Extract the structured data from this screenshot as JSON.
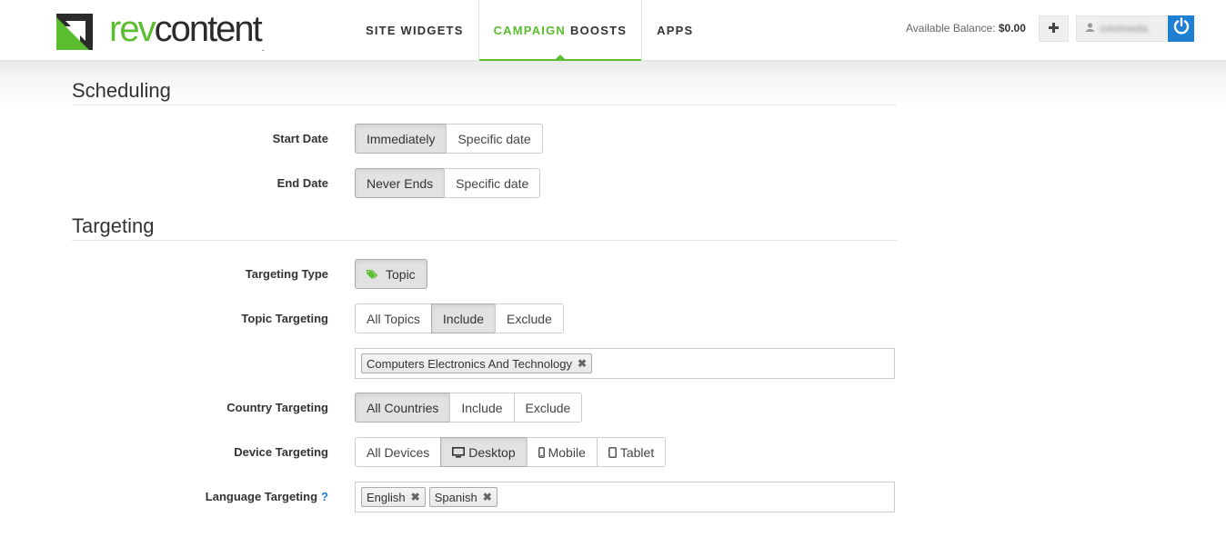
{
  "brand": {
    "name_part1": "rev",
    "name_part2": "content",
    "name_suffix": ".",
    "primary_color": "#5bbd2f",
    "accent_blue": "#1f7fd0"
  },
  "nav": {
    "items": [
      {
        "label": "SITE WIDGETS",
        "active": false
      },
      {
        "label_green": "CAMPAIGN",
        "label": "BOOSTS",
        "active": true
      },
      {
        "label": "APPS",
        "active": false
      }
    ]
  },
  "account": {
    "balance_label": "Available Balance:",
    "balance_value": "$0.00",
    "add_icon": "plus-icon",
    "username": "solutmedia",
    "user_icon": "user-icon",
    "logout_icon": "power-icon"
  },
  "scheduling": {
    "title": "Scheduling",
    "start_date": {
      "label": "Start Date",
      "options": [
        "Immediately",
        "Specific date"
      ],
      "selected": "Immediately"
    },
    "end_date": {
      "label": "End Date",
      "options": [
        "Never Ends",
        "Specific date"
      ],
      "selected": "Never Ends"
    }
  },
  "targeting": {
    "title": "Targeting",
    "type": {
      "label": "Targeting Type",
      "options": [
        "Topic"
      ],
      "icon": "tag-icon",
      "selected": "Topic"
    },
    "topic": {
      "label": "Topic Targeting",
      "options": [
        "All Topics",
        "Include",
        "Exclude"
      ],
      "selected": "Include",
      "tags": [
        "Computers Electronics And Technology"
      ]
    },
    "country": {
      "label": "Country Targeting",
      "options": [
        "All Countries",
        "Include",
        "Exclude"
      ],
      "selected": "All Countries"
    },
    "device": {
      "label": "Device Targeting",
      "options": [
        "All Devices",
        "Desktop",
        "Mobile",
        "Tablet"
      ],
      "icons": [
        "",
        "desktop-icon",
        "mobile-icon",
        "tablet-icon"
      ],
      "selected": "Desktop"
    },
    "language": {
      "label": "Language Targeting",
      "help": "?",
      "tags": [
        "English",
        "Spanish"
      ]
    }
  },
  "tag_remove_glyph": "✖"
}
